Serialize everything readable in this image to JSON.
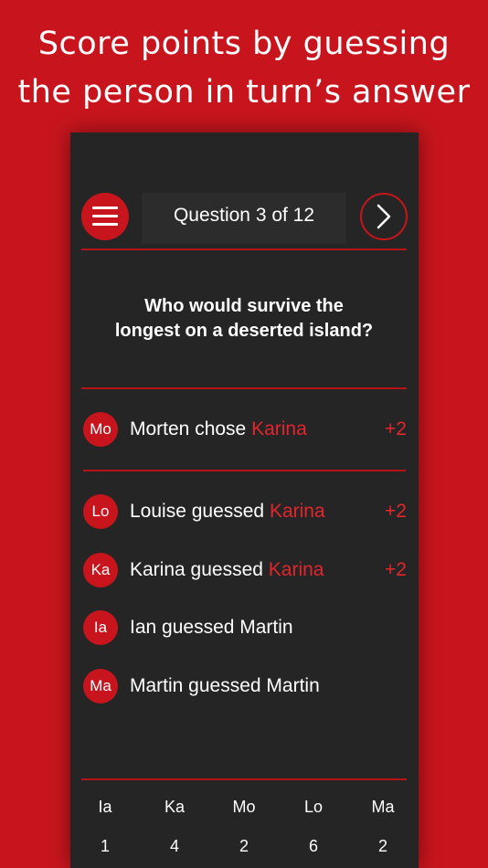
{
  "headline": {
    "line1": "Score points by guessing",
    "line2": "the person in turn’s answer"
  },
  "header": {
    "title": "Question 3 of 12",
    "menu_icon": "hamburger-menu-icon",
    "next_icon": "chevron-right-icon"
  },
  "question": {
    "line1": "Who would survive the",
    "line2": "longest on a deserted island?"
  },
  "chooser": {
    "initials": "Mo",
    "prefix": "Morten chose ",
    "answer": "Karina",
    "points": "+2"
  },
  "guesses": [
    {
      "initials": "Lo",
      "prefix": "Louise guessed ",
      "answer": "Karina",
      "points": "+2"
    },
    {
      "initials": "Ka",
      "prefix": "Karina guessed ",
      "answer": "Karina",
      "points": "+2"
    },
    {
      "initials": "Ia",
      "prefix": "Ian guessed Martin",
      "answer": "",
      "points": ""
    },
    {
      "initials": "Ma",
      "prefix": "Martin guessed Martin",
      "answer": "",
      "points": ""
    }
  ],
  "scoreboard": [
    {
      "name": "Ia",
      "score": "1"
    },
    {
      "name": "Ka",
      "score": "4"
    },
    {
      "name": "Mo",
      "score": "2"
    },
    {
      "name": "Lo",
      "score": "6"
    },
    {
      "name": "Ma",
      "score": "2"
    }
  ],
  "colors": {
    "brand_red": "#c8151d",
    "highlight_red": "#e3252d",
    "panel": "#252525"
  }
}
